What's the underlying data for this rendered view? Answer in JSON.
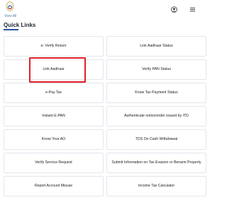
{
  "header": {
    "view_all": "View All",
    "logo_icon": "emblem-logo",
    "user_icon": "user-circle-icon",
    "menu_icon": "hamburger-menu-icon"
  },
  "section": {
    "title": "Quick Links"
  },
  "quick_links": [
    {
      "label": "e- Verify Return"
    },
    {
      "label": "Link Aadhaar Status"
    },
    {
      "label": "Link Aadhaar"
    },
    {
      "label": "Verify PAN Status"
    },
    {
      "label": "e-Pay Tax"
    },
    {
      "label": "Know Tax Payment Status"
    },
    {
      "label": "Instant E-PAN"
    },
    {
      "label": "Authenticate notice/order issued by ITD"
    },
    {
      "label": "Know Your AO"
    },
    {
      "label": "TDS On Cash Withdrawal"
    },
    {
      "label": "Verify Service Request"
    },
    {
      "label": "Submit Information on Tax Evasion or Benami Property"
    },
    {
      "label": "Report Account Misuse"
    },
    {
      "label": "Income Tax Calculator"
    }
  ],
  "colors": {
    "accent": "#2b4fa3",
    "highlight": "#e0202a"
  }
}
